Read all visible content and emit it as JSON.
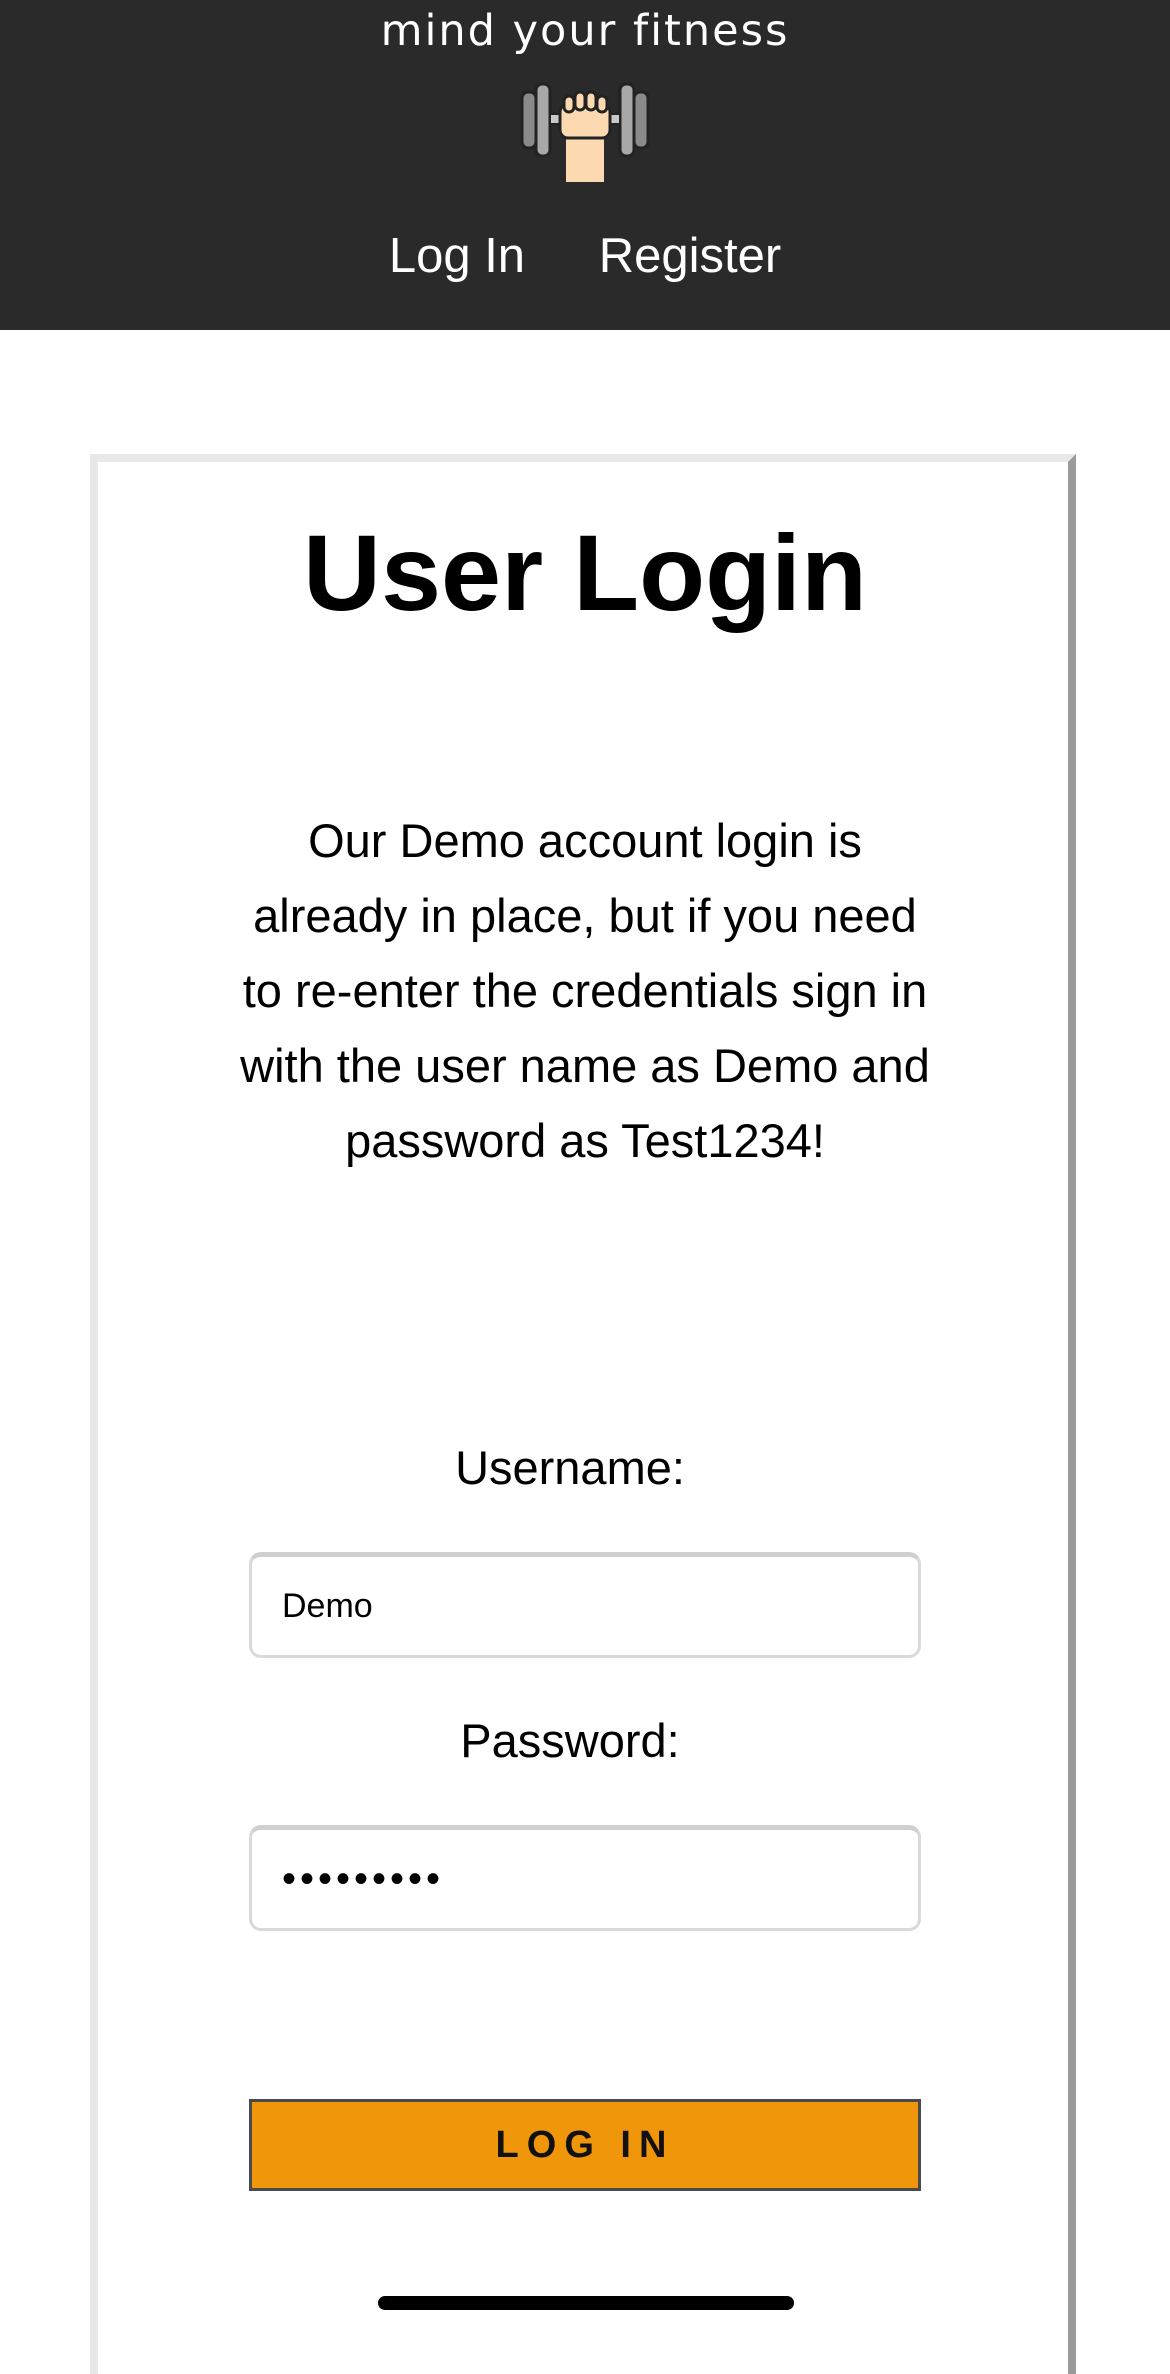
{
  "header": {
    "brand": "mind your fitness",
    "logo_icon": "dumbbell-fist-icon",
    "nav": [
      {
        "label": "Log In"
      },
      {
        "label": "Register"
      }
    ],
    "background": "#2a2a2a"
  },
  "login": {
    "title": "User Login",
    "intro": "Our Demo account login is already in place, but if you need to re-enter the credentials sign in with the user name as Demo and password as Test1234!",
    "username_label": "Username:",
    "username_value": "Demo",
    "password_label": "Password:",
    "password_value": "•••••••••",
    "submit_label": "LOG IN",
    "accent": "#f0960a"
  }
}
